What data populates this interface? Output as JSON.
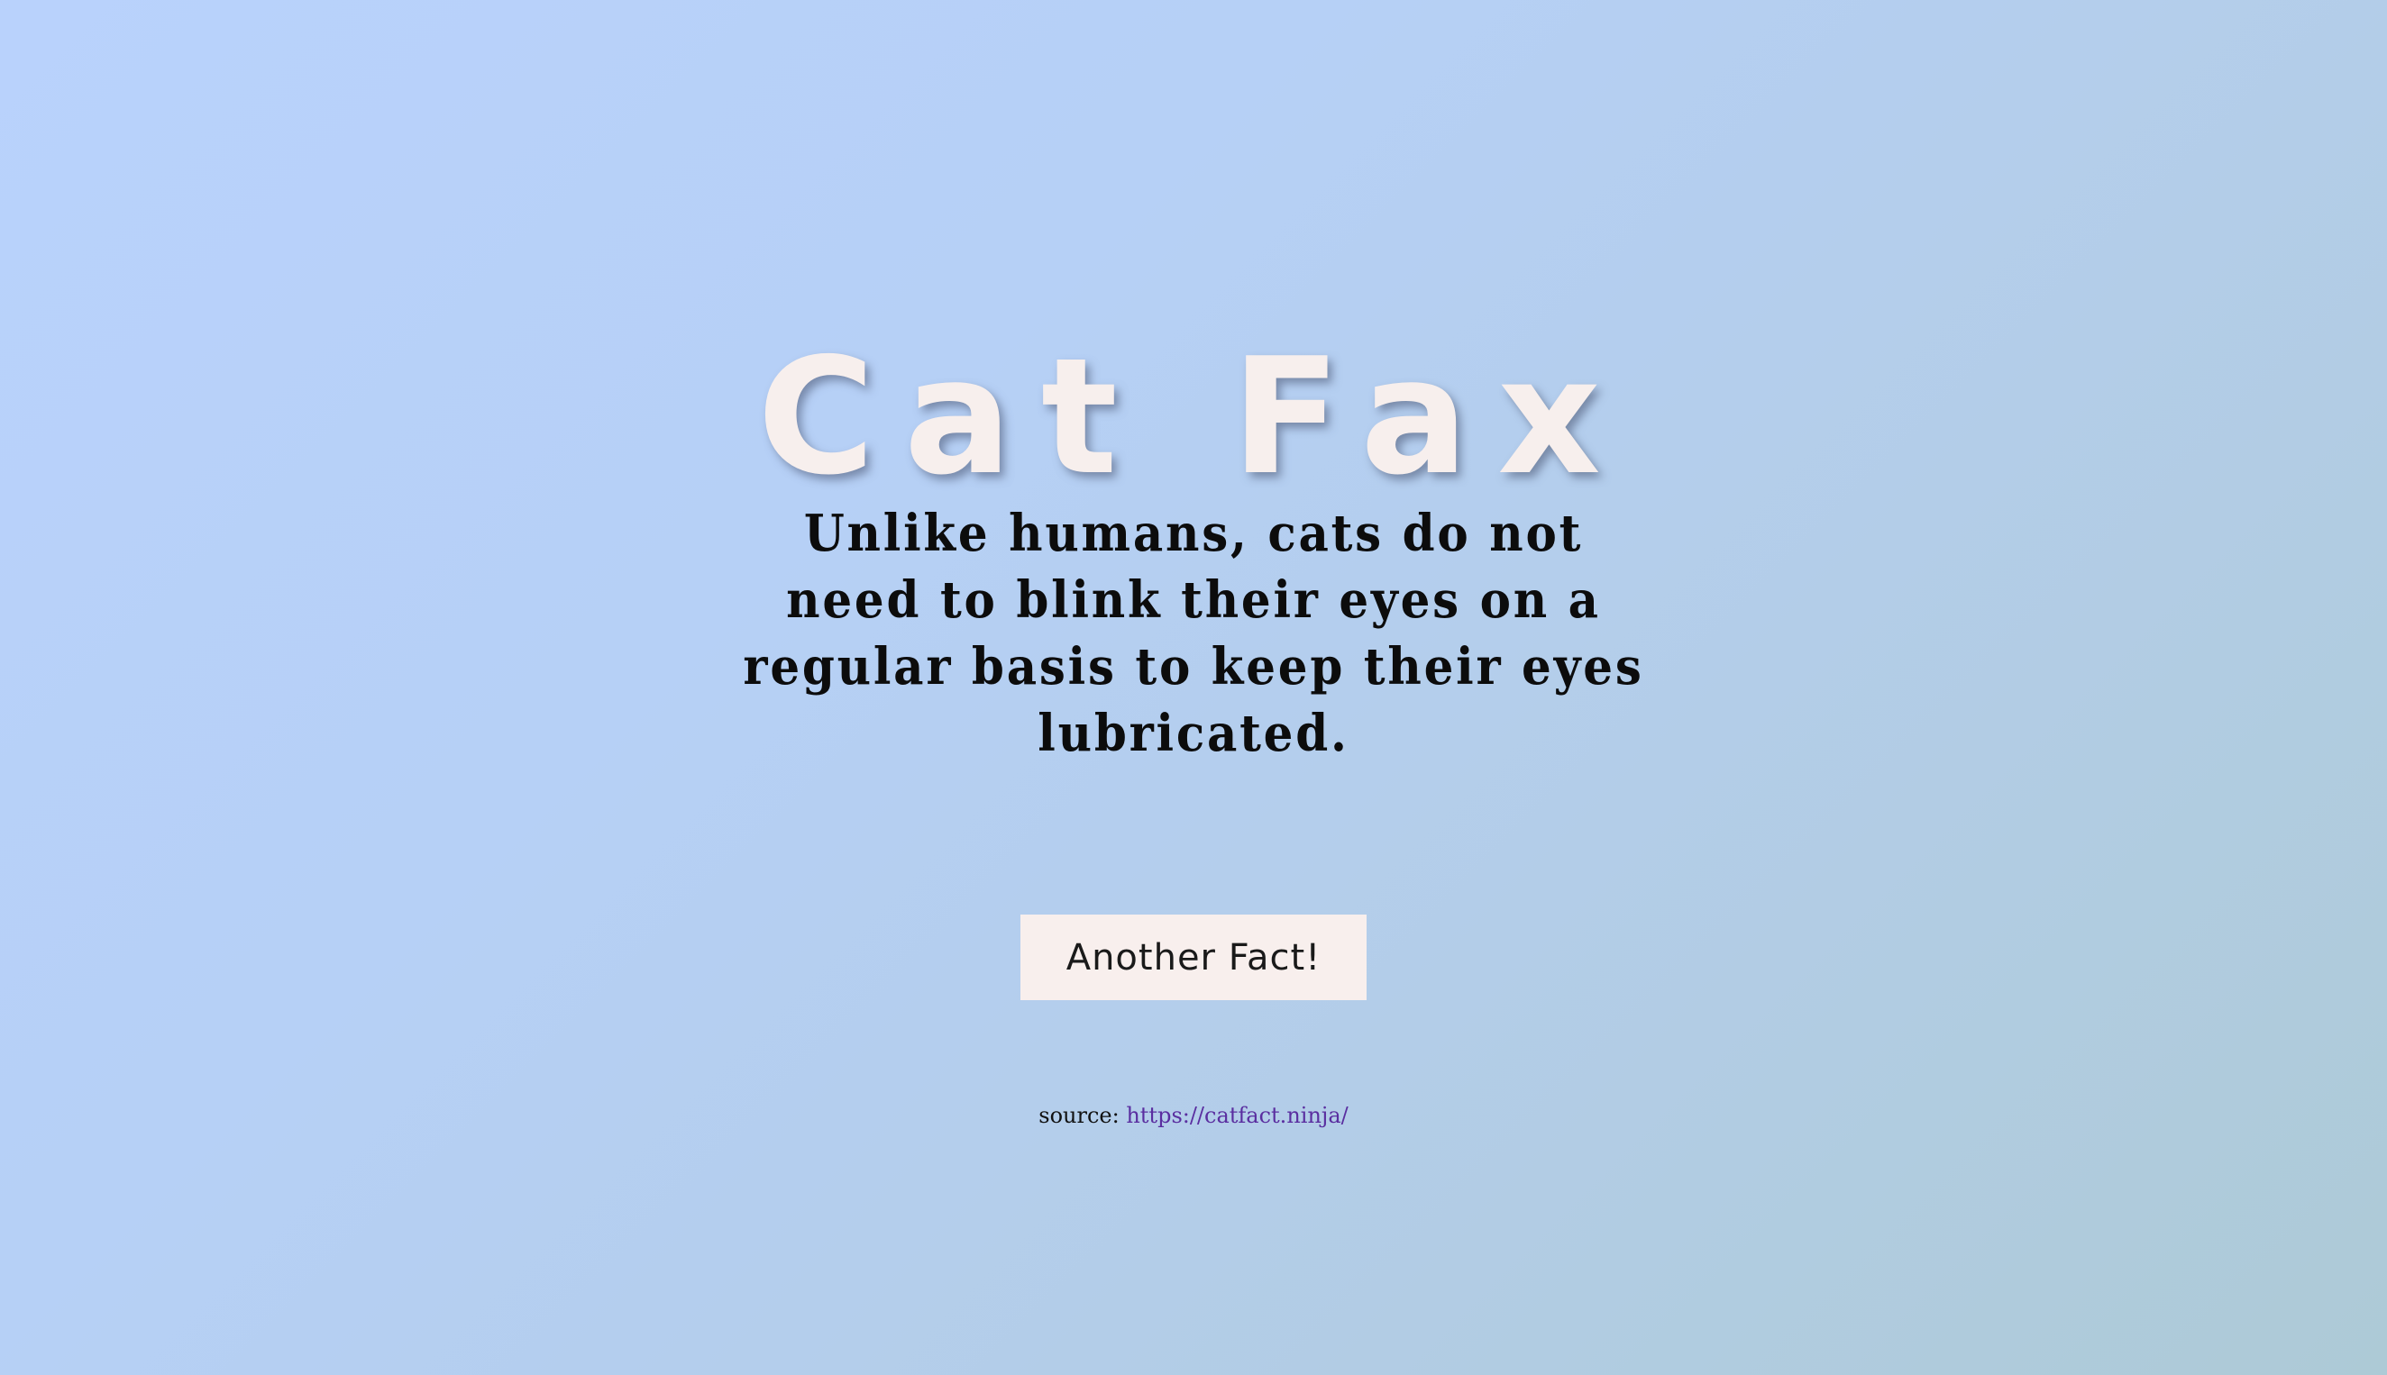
{
  "header": {
    "title": "Cat Fax"
  },
  "main": {
    "fact_text": "Unlike humans, cats do not need to blink their eyes on a regular basis to keep their eyes lubricated.",
    "button_label": "Another Fact!"
  },
  "footer": {
    "source_label": "source:",
    "source_link_text": "https://catfact.ninja/"
  },
  "colors": {
    "background_start": "#b9d2fc",
    "background_end": "#adcad6",
    "title_color": "#f7efed",
    "button_bg": "#f8efed",
    "link_color": "#5a2ea0"
  }
}
